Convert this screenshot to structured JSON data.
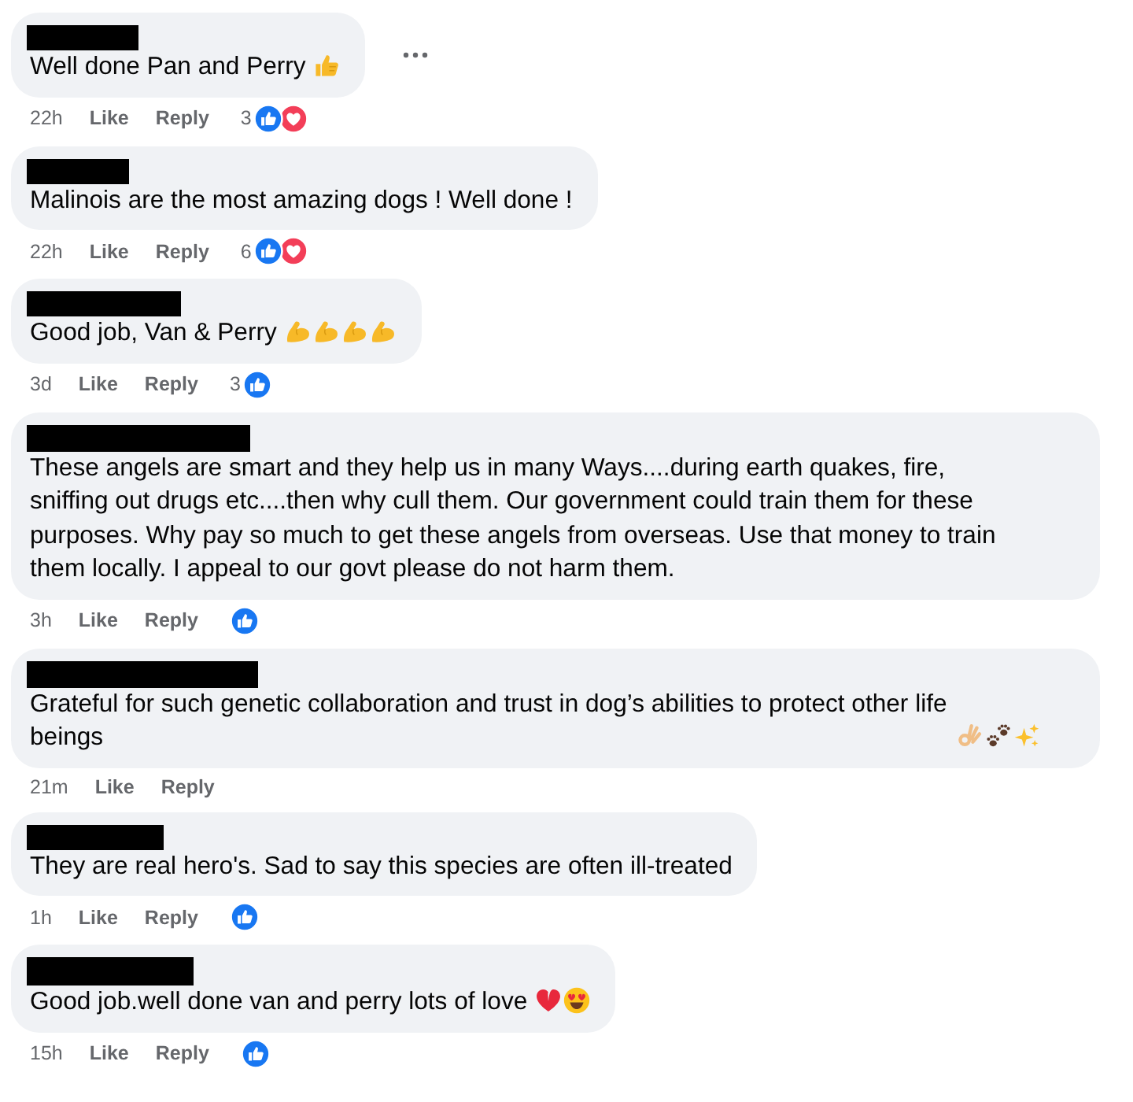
{
  "comments": [
    {
      "text": "Well done Pan and Perry",
      "emojis": [
        {
          "kind": "thumbs_up"
        }
      ],
      "more_options": true,
      "time": "22h",
      "actions": [
        "Like",
        "Reply"
      ],
      "reactions": {
        "count": "3",
        "types": [
          {
            "kind": "like"
          },
          {
            "kind": "love"
          }
        ]
      }
    },
    {
      "text": "Malinois are the most amazing dogs ! Well done !",
      "more_options": false,
      "time": "22h",
      "actions": [
        "Like",
        "Reply"
      ],
      "reactions": {
        "count": "6",
        "types": [
          {
            "kind": "like"
          },
          {
            "kind": "love"
          }
        ]
      }
    },
    {
      "text": "Good job, Van & Perry",
      "emojis": [
        {
          "kind": "flexed_biceps"
        },
        {
          "kind": "flexed_biceps"
        },
        {
          "kind": "flexed_biceps"
        },
        {
          "kind": "flexed_biceps"
        }
      ],
      "more_options": false,
      "time": "3d",
      "actions": [
        "Like",
        "Reply"
      ],
      "reactions": {
        "count": "3",
        "types": [
          {
            "kind": "like"
          }
        ]
      }
    },
    {
      "text": "These angels are smart and they help us in many Ways....during earth quakes, fire, sniffing out drugs etc....then why cull them. Our government could train them for these purposes. Why pay so much to get these angels from overseas. Use that money to train them locally. I appeal to our govt please do not harm them.",
      "more_options": false,
      "time": "3h",
      "actions": [
        "Like",
        "Reply"
      ],
      "reactions": {
        "types": [
          {
            "kind": "like"
          }
        ]
      }
    },
    {
      "text": "Grateful for such genetic collaboration and trust in dog’s abilities to protect other life beings",
      "emojis": [
        {
          "kind": "ok_hand"
        },
        {
          "kind": "paw_prints"
        },
        {
          "kind": "sparkles"
        }
      ],
      "more_options": false,
      "time": "21m",
      "actions": [
        "Like",
        "Reply"
      ]
    },
    {
      "text": "They are real hero's. Sad to say this species are often ill-treated",
      "more_options": false,
      "time": "1h",
      "actions": [
        "Like",
        "Reply"
      ],
      "reactions": {
        "types": [
          {
            "kind": "like"
          }
        ]
      }
    },
    {
      "text": "Good job.well done van and perry lots of love",
      "emojis": [
        {
          "kind": "red_heart"
        },
        {
          "kind": "heart_eyes"
        }
      ],
      "more_options": false,
      "time": "15h",
      "actions": [
        "Like",
        "Reply"
      ],
      "reactions": {
        "types": [
          {
            "kind": "like"
          }
        ]
      }
    }
  ]
}
